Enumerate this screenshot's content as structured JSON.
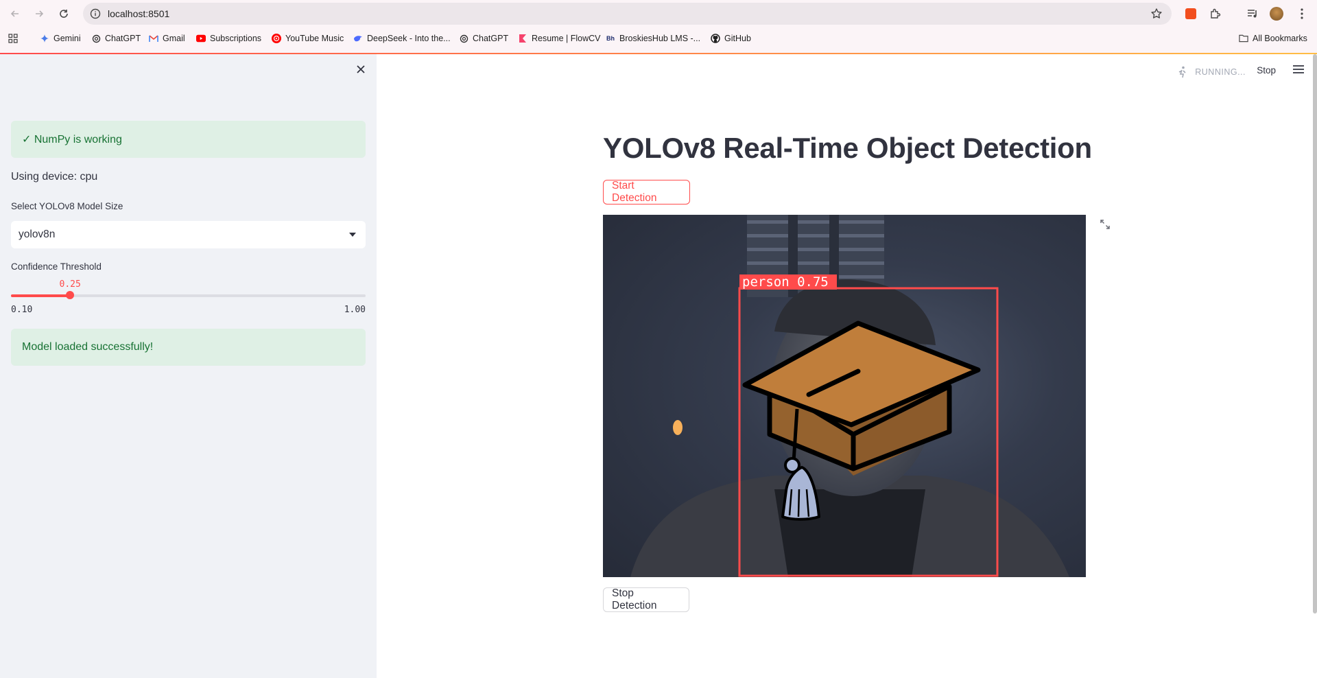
{
  "browser": {
    "url": "localhost:8501",
    "bookmarks": [
      {
        "label": "Gemini",
        "icon": "gemini-icon"
      },
      {
        "label": "ChatGPT",
        "icon": "chatgpt-icon"
      },
      {
        "label": "Gmail",
        "icon": "gmail-icon"
      },
      {
        "label": "Subscriptions",
        "icon": "youtube-icon"
      },
      {
        "label": "YouTube Music",
        "icon": "youtube-music-icon"
      },
      {
        "label": "DeepSeek - Into the...",
        "icon": "deepseek-icon"
      },
      {
        "label": "ChatGPT",
        "icon": "chatgpt-icon"
      },
      {
        "label": "Resume | FlowCV",
        "icon": "flowcv-icon"
      },
      {
        "label": "BroskiesHub LMS -...",
        "icon": "broskieshub-icon"
      },
      {
        "label": "GitHub",
        "icon": "github-icon"
      }
    ],
    "all_bookmarks": "All Bookmarks"
  },
  "sidebar": {
    "numpy_status": "✓ NumPy is working",
    "device_text": "Using device: cpu",
    "model_label": "Select YOLOv8 Model Size",
    "model_value": "yolov8n",
    "confidence_label": "Confidence Threshold",
    "confidence": {
      "value": "0.25",
      "min": "0.10",
      "max": "1.00",
      "fraction": 0.1667
    },
    "model_status": "Model loaded successfully!"
  },
  "main": {
    "running_text": "RUNNING...",
    "stop_text": "Stop",
    "title": "YOLOv8 Real-Time Object Detection",
    "start_button": "Start Detection",
    "stop_button": "Stop Detection",
    "detection_label": "person 0.75"
  },
  "colors": {
    "accent": "#ff4b4b",
    "success_bg": "#dff0e5",
    "success_text": "#177233",
    "sidebar_bg": "#f0f2f6",
    "detection_box": "#ff4b4b"
  }
}
